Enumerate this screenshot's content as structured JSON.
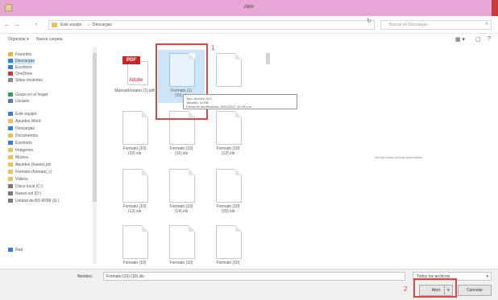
{
  "window": {
    "title": "Abrir"
  },
  "address": {
    "back": "←",
    "forward": "→",
    "up": "↑",
    "crumbs": [
      "Este equipo",
      "Descargas"
    ],
    "refresh": "↻",
    "search_placeholder": "Buscar en Descargas"
  },
  "toolbar": {
    "organize": "Organizar ▾",
    "new_folder": "Nueva carpeta",
    "view": "▦ ▾",
    "pane": "▢",
    "help": "?"
  },
  "nav": {
    "items": [
      {
        "label": "Favoritos",
        "icon": "star-icon",
        "color": "#e6b93a"
      },
      {
        "label": "Descargas",
        "icon": "download-folder-icon",
        "color": "#3a7bd5",
        "selected": true
      },
      {
        "label": "Escritorio",
        "icon": "desktop-icon",
        "color": "#3a7bd5"
      },
      {
        "label": "OneDrive",
        "icon": "cloud-icon",
        "color": "#c93a3a"
      },
      {
        "label": "Sitios recientes",
        "icon": "recent-icon",
        "color": "#8a8a8a"
      },
      {
        "label": "Grupo en el hogar",
        "icon": "homegroup-icon",
        "color": "#3a9a5a"
      },
      {
        "label": "Usuario",
        "icon": "user-icon",
        "color": "#5a7ab5"
      },
      {
        "label": "Este equipo",
        "icon": "computer-icon",
        "color": "#3a7bd5"
      },
      {
        "label": "Apuntes Word",
        "icon": "folder-icon",
        "color": "#e6c35b"
      },
      {
        "label": "Descargas",
        "icon": "download-folder-icon",
        "color": "#3a7bd5"
      },
      {
        "label": "Documentos",
        "icon": "documents-icon",
        "color": "#e6c35b"
      },
      {
        "label": "Escritorio",
        "icon": "desktop-icon",
        "color": "#3a7bd5"
      },
      {
        "label": "Imágenes",
        "icon": "pictures-icon",
        "color": "#e6c35b"
      },
      {
        "label": "Música",
        "icon": "music-icon",
        "color": "#e6c35b"
      },
      {
        "label": "Apuntes (hueso).pd",
        "icon": "folder-icon",
        "color": "#e6c35b"
      },
      {
        "label": "Formato (formato_c)",
        "icon": "folder-icon",
        "color": "#e6c35b"
      },
      {
        "label": "Vídeos",
        "icon": "videos-icon",
        "color": "#e6c35b"
      },
      {
        "label": "Disco local (C:)",
        "icon": "drive-icon",
        "color": "#7a7a7a"
      },
      {
        "label": "Nuevo vol (D:)",
        "icon": "drive-icon",
        "color": "#7a7a7a"
      },
      {
        "label": "Unidad de BD-ROM (G:)",
        "icon": "disc-drive-icon",
        "color": "#7a7a7a"
      },
      {
        "label": "Red",
        "icon": "network-icon",
        "color": "#3a7bd5"
      }
    ]
  },
  "files": [
    {
      "name": "ManualUsuario (1).pdf",
      "kind": "pdf",
      "pdf_badge": "PDF",
      "adobe": "Adobe"
    },
    {
      "name": "Formato (1)\n(10).xls",
      "kind": "doc",
      "selected": true
    },
    {
      "name": "",
      "kind": "doc"
    },
    {
      "name": "Formato (10)\n(10).xls",
      "kind": "doc"
    },
    {
      "name": "Formato (10)\n(11).xls",
      "kind": "doc"
    },
    {
      "name": "Formato (10)\n(12).xls",
      "kind": "doc"
    },
    {
      "name": "Formato (10)\n(13).xls",
      "kind": "doc"
    },
    {
      "name": "Formato (10)\n(14).xls",
      "kind": "doc"
    },
    {
      "name": "Formato (10)\n(15).xls",
      "kind": "doc"
    },
    {
      "name": "Formato (10)",
      "kind": "doc"
    },
    {
      "name": "Formato (10)",
      "kind": "doc"
    },
    {
      "name": "Formato (10)",
      "kind": "doc"
    }
  ],
  "tooltip": {
    "line1": "Tipo: Archivo XLS",
    "line2": "Tamaño: 14 KB",
    "line3": "Fecha de modificación: 26/11/2017 19:45 p.m."
  },
  "preview": {
    "message": "No hay vistas previas disponibles."
  },
  "annotations": {
    "one": "1",
    "two": "2"
  },
  "bottom": {
    "filename_label": "Nombre:",
    "filename_value": "Formato (10) (10).xls",
    "type_value": "Todos los archivos",
    "type_chevron": "▾",
    "open_label": "Abrir",
    "open_split": "▾",
    "cancel_label": "Cancelar"
  }
}
